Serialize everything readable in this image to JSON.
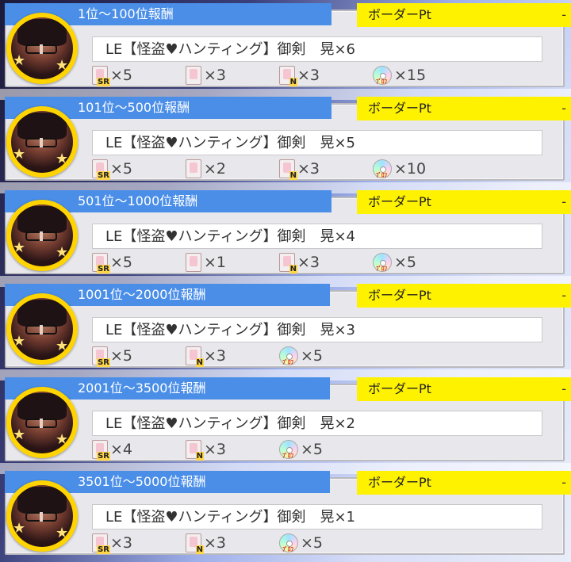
{
  "colors": {
    "title_bar": "#4a8ee8",
    "border_tab": "#fff200",
    "avatar_ring": "#ffd400"
  },
  "cards": [
    {
      "title": "1位〜100位報酬",
      "border_label": "ボーダーPt",
      "border_value": "-",
      "item": "LE【怪盗♥ハンティング】御剣　晃×6",
      "rewards": [
        {
          "icon": "sr-ticket-icon",
          "tag": "SR",
          "qty": "×5"
        },
        {
          "icon": "ticket-icon",
          "tag": "",
          "qty": "×3"
        },
        {
          "icon": "n-ticket-icon",
          "tag": "N",
          "qty": "×3"
        },
        {
          "icon": "disc-icon",
          "tag": "",
          "qty": "×15"
        }
      ]
    },
    {
      "title": "101位〜500位報酬",
      "border_label": "ボーダーPt",
      "border_value": "-",
      "item": "LE【怪盗♥ハンティング】御剣　晃×5",
      "rewards": [
        {
          "icon": "sr-ticket-icon",
          "tag": "SR",
          "qty": "×5"
        },
        {
          "icon": "ticket-icon",
          "tag": "",
          "qty": "×2"
        },
        {
          "icon": "n-ticket-icon",
          "tag": "N",
          "qty": "×3"
        },
        {
          "icon": "disc-icon",
          "tag": "",
          "qty": "×10"
        }
      ]
    },
    {
      "title": "501位〜1000位報酬",
      "border_label": "ボーダーPt",
      "border_value": "-",
      "item": "LE【怪盗♥ハンティング】御剣　晃×4",
      "rewards": [
        {
          "icon": "sr-ticket-icon",
          "tag": "SR",
          "qty": "×5"
        },
        {
          "icon": "ticket-icon",
          "tag": "",
          "qty": "×1"
        },
        {
          "icon": "n-ticket-icon",
          "tag": "N",
          "qty": "×3"
        },
        {
          "icon": "disc-icon",
          "tag": "",
          "qty": "×5"
        }
      ]
    },
    {
      "title": "1001位〜2000位報酬",
      "border_label": "ボーダーPt",
      "border_value": "-",
      "item": "LE【怪盗♥ハンティング】御剣　晃×3",
      "rewards": [
        {
          "icon": "sr-ticket-icon",
          "tag": "SR",
          "qty": "×5"
        },
        {
          "icon": "n-ticket-icon",
          "tag": "N",
          "qty": "×3"
        },
        {
          "icon": "disc-icon",
          "tag": "",
          "qty": "×5"
        }
      ]
    },
    {
      "title": "2001位〜3500位報酬",
      "border_label": "ボーダーPt",
      "border_value": "-",
      "item": "LE【怪盗♥ハンティング】御剣　晃×2",
      "rewards": [
        {
          "icon": "sr-ticket-icon",
          "tag": "SR",
          "qty": "×4"
        },
        {
          "icon": "n-ticket-icon",
          "tag": "N",
          "qty": "×3"
        },
        {
          "icon": "disc-icon",
          "tag": "",
          "qty": "×5"
        }
      ]
    },
    {
      "title": "3501位〜5000位報酬",
      "border_label": "ボーダーPt",
      "border_value": "-",
      "item": "LE【怪盗♥ハンティング】御剣　晃×1",
      "rewards": [
        {
          "icon": "sr-ticket-icon",
          "tag": "SR",
          "qty": "×3"
        },
        {
          "icon": "n-ticket-icon",
          "tag": "N",
          "qty": "×3"
        },
        {
          "icon": "disc-icon",
          "tag": "",
          "qty": "×5"
        }
      ]
    }
  ]
}
